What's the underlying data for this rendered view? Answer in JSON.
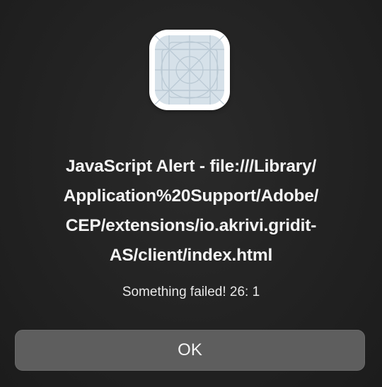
{
  "dialog": {
    "title_lines": [
      "JavaScript Alert - file:///Library/",
      "Application%20Support/Adobe/",
      "CEP/extensions/io.akrivi.gridit-",
      "AS/client/index.html"
    ],
    "message": "Something failed! 26: 1",
    "ok_label": "OK",
    "icon": "generic-app-icon"
  },
  "colors": {
    "background": "#222222",
    "button": "#5e5e5e",
    "text": "#f4f4f4",
    "icon_fill": "#d5e0e8",
    "icon_lines": "#b7c6d1"
  }
}
